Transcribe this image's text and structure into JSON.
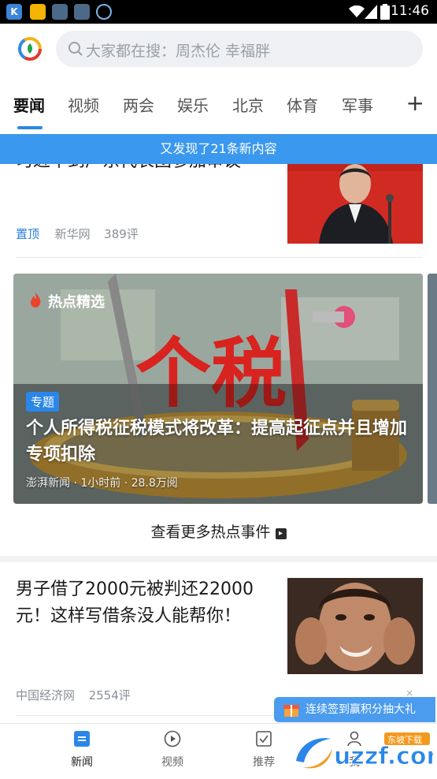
{
  "status_bar": {
    "time": "11:46"
  },
  "search": {
    "placeholder": "大家都在搜：周杰伦 幸福胖"
  },
  "tabs": [
    {
      "label": "要闻",
      "active": true
    },
    {
      "label": "视频"
    },
    {
      "label": "两会"
    },
    {
      "label": "娱乐"
    },
    {
      "label": "北京"
    },
    {
      "label": "体育"
    },
    {
      "label": "军事"
    }
  ],
  "tabs_add_label": "+",
  "notice": "又发现了21条新内容",
  "article1": {
    "title": "习近平到广东代表团参加审议",
    "pin": "置顶",
    "source": "新华网",
    "comments": "389评"
  },
  "hot_card": {
    "label": "热点精选",
    "badge": "专题",
    "title": "个人所得税征税模式将改革：提高起征点并且增加专项扣除",
    "meta": "澎湃新闻 · 1小时前 · 28.8万阅",
    "image_text": "个税"
  },
  "more_hot": "查看更多热点事件",
  "article2": {
    "title": "男子借了2000元被判还22000元！这样写借条没人能帮你！",
    "source": "中国经济网",
    "comments": "2554评"
  },
  "promo": {
    "text": "连续签到赢积分抽大礼",
    "close": "×"
  },
  "bottom_nav": [
    {
      "label": "新闻",
      "active": true
    },
    {
      "label": "视频"
    },
    {
      "label": "推荐"
    },
    {
      "label": "我"
    }
  ],
  "watermark": {
    "text": "uzzf.com",
    "tag": "东坡下载"
  },
  "colors": {
    "accent": "#2a87e8",
    "notice_bg": "#3a98ee",
    "tab_text": "#555555"
  }
}
